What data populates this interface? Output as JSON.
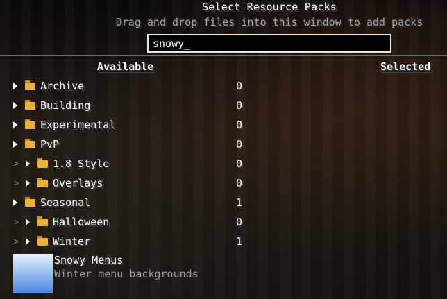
{
  "title": "Select Resource Packs",
  "subtitle": "Drag and drop files into this window to add packs",
  "search": {
    "value": "snowy_",
    "placeholder": ""
  },
  "headers": {
    "available": "Available",
    "selected": "Selected"
  },
  "available_items": [
    {
      "label": "Archive",
      "count": "0",
      "depth": 0,
      "type": "folder"
    },
    {
      "label": "Building",
      "count": "0",
      "depth": 0,
      "type": "folder"
    },
    {
      "label": "Experimental",
      "count": "0",
      "depth": 0,
      "type": "folder"
    },
    {
      "label": "PvP",
      "count": "0",
      "depth": 0,
      "type": "folder"
    },
    {
      "label": "1.8 Style",
      "count": "0",
      "depth": 1,
      "type": "folder"
    },
    {
      "label": "Overlays",
      "count": "0",
      "depth": 1,
      "type": "folder"
    },
    {
      "label": "Seasonal",
      "count": "1",
      "depth": 0,
      "type": "folder"
    },
    {
      "label": "Halloween",
      "count": "0",
      "depth": 1,
      "type": "folder"
    },
    {
      "label": "Winter",
      "count": "1",
      "depth": 1,
      "type": "folder"
    }
  ],
  "pack": {
    "name": "Snowy Menus",
    "description": "Winter menu backgrounds"
  },
  "colors": {
    "folder": "#e9b23c",
    "secondary_text": "#a8a8a8",
    "search_border": "#e8e8e8"
  },
  "icons": {
    "expand": "chevron-right-icon",
    "folder": "folder-icon",
    "nested": "nested-marker-icon"
  }
}
